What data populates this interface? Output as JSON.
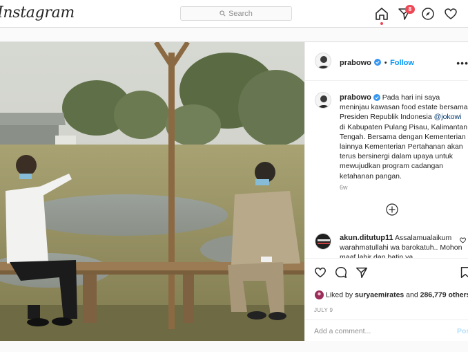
{
  "app": {
    "logo_text": "Instagram"
  },
  "search": {
    "placeholder": "Search"
  },
  "nav": {
    "notification_count": "8"
  },
  "post": {
    "username": "prabowo",
    "follow_label": "Follow",
    "more_label": "•••",
    "caption_parts": {
      "before_mention": "Pada hari ini saya meninjau kawasan food estate bersama Presiden Republik Indonesia ",
      "mention": "@jokowi",
      "after_mention": " di Kabupaten Pulang Pisau, Kalimantan Tengah. Bersama dengan Kementerian lainnya Kementerian Pertahanan akan terus bersinergi dalam upaya untuk mewujudkan program cadangan ketahanan pangan."
    },
    "caption_time": "6w",
    "comment": {
      "username": "akun.ditutup11",
      "text": " Assalamualaikum warahmatullahi wa barokatuh.. Mohon maaf lahir dan batin ya"
    },
    "likes": {
      "prefix": "Liked by ",
      "user": "suryaemirates",
      "middle": " and ",
      "count": "286,779 others"
    },
    "date": "JULY 9",
    "add_comment_placeholder": "Add a comment...",
    "post_button": "Post"
  },
  "colors": {
    "accent": "#0095f6",
    "badge": "#ed4956",
    "border": "#dbdbdb"
  },
  "icons": [
    "search-icon",
    "home-icon",
    "direct-icon",
    "explore-icon",
    "heart-icon",
    "verified-icon",
    "plus-circle-icon",
    "comment-icon",
    "share-icon",
    "save-icon"
  ]
}
